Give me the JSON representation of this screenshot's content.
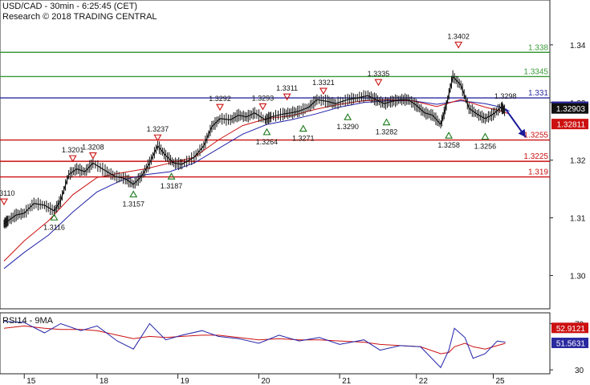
{
  "chart_data": {
    "type": "line",
    "title": "USD/CAD - 30min - 6:25:45 (CET)",
    "subtitle": "Research © 2018 TRADING CENTRAL",
    "ylim": [
      1.2945,
      1.3475
    ],
    "y_ticks": [
      1.3,
      1.31,
      1.32,
      1.33,
      1.34
    ],
    "y_tick_labels": [
      "1.30",
      "1.31",
      "1.32",
      "1.33",
      "1.34"
    ],
    "x_ticks": [
      {
        "label": "15",
        "x": 0.3
      },
      {
        "label": "18",
        "x": 1.2
      },
      {
        "label": "19",
        "x": 2.2
      },
      {
        "label": "20",
        "x": 3.2
      },
      {
        "label": "21",
        "x": 4.2
      },
      {
        "label": "22",
        "x": 5.15
      },
      {
        "label": "25",
        "x": 6.1
      }
    ],
    "xlim": [
      0,
      6.8
    ],
    "price_series": {
      "name": "USD/CAD",
      "points": [
        [
          0.05,
          1.309
        ],
        [
          0.1,
          1.3095
        ],
        [
          0.2,
          1.3105
        ],
        [
          0.3,
          1.3108
        ],
        [
          0.42,
          1.3125
        ],
        [
          0.55,
          1.3122
        ],
        [
          0.67,
          1.3112
        ],
        [
          0.75,
          1.313
        ],
        [
          0.85,
          1.3175
        ],
        [
          0.95,
          1.3185
        ],
        [
          1.05,
          1.318
        ],
        [
          1.15,
          1.3195
        ],
        [
          1.3,
          1.3182
        ],
        [
          1.42,
          1.3172
        ],
        [
          1.55,
          1.3168
        ],
        [
          1.65,
          1.3158
        ],
        [
          1.75,
          1.3172
        ],
        [
          1.85,
          1.3195
        ],
        [
          1.95,
          1.3225
        ],
        [
          2.05,
          1.3208
        ],
        [
          2.15,
          1.3195
        ],
        [
          2.25,
          1.3193
        ],
        [
          2.4,
          1.3205
        ],
        [
          2.52,
          1.3225
        ],
        [
          2.62,
          1.3258
        ],
        [
          2.72,
          1.3272
        ],
        [
          2.85,
          1.327
        ],
        [
          2.95,
          1.3278
        ],
        [
          3.05,
          1.3275
        ],
        [
          3.15,
          1.3282
        ],
        [
          3.28,
          1.327
        ],
        [
          3.35,
          1.3275
        ],
        [
          3.5,
          1.328
        ],
        [
          3.6,
          1.3282
        ],
        [
          3.7,
          1.3285
        ],
        [
          3.82,
          1.3292
        ],
        [
          3.92,
          1.3305
        ],
        [
          4.05,
          1.3302
        ],
        [
          4.15,
          1.3298
        ],
        [
          4.3,
          1.3305
        ],
        [
          4.42,
          1.3308
        ],
        [
          4.55,
          1.3312
        ],
        [
          4.65,
          1.3305
        ],
        [
          4.75,
          1.3298
        ],
        [
          4.85,
          1.3302
        ],
        [
          4.95,
          1.3305
        ],
        [
          5.05,
          1.3305
        ],
        [
          5.15,
          1.3295
        ],
        [
          5.25,
          1.3282
        ],
        [
          5.35,
          1.3278
        ],
        [
          5.45,
          1.3262
        ],
        [
          5.52,
          1.3295
        ],
        [
          5.6,
          1.3345
        ],
        [
          5.7,
          1.333
        ],
        [
          5.8,
          1.329
        ],
        [
          5.9,
          1.328
        ],
        [
          6.0,
          1.3272
        ],
        [
          6.1,
          1.328
        ],
        [
          6.2,
          1.3292
        ],
        [
          6.25,
          1.3285
        ]
      ]
    },
    "ma_fast": {
      "name": "MA (red)",
      "color": "#cc1111",
      "points": [
        [
          0.05,
          1.3025
        ],
        [
          0.3,
          1.306
        ],
        [
          0.6,
          1.3095
        ],
        [
          0.9,
          1.314
        ],
        [
          1.2,
          1.317
        ],
        [
          1.5,
          1.3178
        ],
        [
          1.8,
          1.3185
        ],
        [
          2.1,
          1.3195
        ],
        [
          2.4,
          1.3205
        ],
        [
          2.7,
          1.3235
        ],
        [
          3.0,
          1.326
        ],
        [
          3.3,
          1.3272
        ],
        [
          3.6,
          1.3277
        ],
        [
          3.9,
          1.3288
        ],
        [
          4.2,
          1.3297
        ],
        [
          4.5,
          1.3303
        ],
        [
          4.8,
          1.3305
        ],
        [
          5.1,
          1.3303
        ],
        [
          5.4,
          1.3293
        ],
        [
          5.7,
          1.3305
        ],
        [
          6.0,
          1.3292
        ],
        [
          6.2,
          1.3285
        ],
        [
          6.3,
          1.328
        ]
      ]
    },
    "ma_slow": {
      "name": "MA (blue)",
      "color": "#2222aa",
      "points": [
        [
          0.05,
          1.3012
        ],
        [
          0.3,
          1.304
        ],
        [
          0.6,
          1.307
        ],
        [
          0.9,
          1.311
        ],
        [
          1.2,
          1.3145
        ],
        [
          1.5,
          1.3165
        ],
        [
          1.8,
          1.3175
        ],
        [
          2.1,
          1.318
        ],
        [
          2.4,
          1.3195
        ],
        [
          2.7,
          1.322
        ],
        [
          3.0,
          1.3245
        ],
        [
          3.3,
          1.3262
        ],
        [
          3.6,
          1.327
        ],
        [
          3.9,
          1.328
        ],
        [
          4.2,
          1.3292
        ],
        [
          4.5,
          1.33
        ],
        [
          4.8,
          1.3303
        ],
        [
          5.1,
          1.3303
        ],
        [
          5.4,
          1.3297
        ],
        [
          5.7,
          1.3303
        ],
        [
          6.0,
          1.3298
        ],
        [
          6.2,
          1.3292
        ],
        [
          6.3,
          1.3285
        ]
      ]
    },
    "levels": [
      {
        "label": "1.338",
        "value": 1.3387,
        "color": "#3a9a3a"
      },
      {
        "label": "1.3345",
        "value": 1.3345,
        "color": "#3a9a3a"
      },
      {
        "label": "1.331",
        "value": 1.3308,
        "color": "#2a2aa0"
      },
      {
        "label": "1.3255",
        "value": 1.3235,
        "color": "#cc1111"
      },
      {
        "label": "1.3225",
        "value": 1.3198,
        "color": "#cc1111"
      },
      {
        "label": "1.319",
        "value": 1.3171,
        "color": "#cc1111"
      }
    ],
    "price_tags": [
      {
        "label": "1.32916",
        "value": 1.3292,
        "bg": "#2a2aa0",
        "fg": "#ffffff"
      },
      {
        "label": "1.32903",
        "value": 1.3289,
        "bg": "#111111",
        "fg": "#ffffff"
      },
      {
        "label": "1.32811",
        "value": 1.3262,
        "bg": "#cc1111",
        "fg": "#ffffff"
      }
    ],
    "annotations": [
      {
        "label": "1.3110",
        "x": 0.05,
        "value": 1.3123,
        "kind": "top"
      },
      {
        "label": "1.3116",
        "x": 0.67,
        "value": 1.3106,
        "kind": "bottom"
      },
      {
        "label": "1.3201",
        "x": 0.9,
        "value": 1.3198,
        "kind": "top"
      },
      {
        "label": "1.3208",
        "x": 1.15,
        "value": 1.3203,
        "kind": "top"
      },
      {
        "label": "1.3157",
        "x": 1.65,
        "value": 1.3146,
        "kind": "bottom"
      },
      {
        "label": "1.3237",
        "x": 1.95,
        "value": 1.3234,
        "kind": "top"
      },
      {
        "label": "1.3187",
        "x": 2.12,
        "value": 1.3177,
        "kind": "bottom"
      },
      {
        "label": "1.3292",
        "x": 2.72,
        "value": 1.3287,
        "kind": "top"
      },
      {
        "label": "1.3264",
        "x": 3.3,
        "value": 1.3254,
        "kind": "bottom"
      },
      {
        "label": "1.3293",
        "x": 3.25,
        "value": 1.3288,
        "kind": "top"
      },
      {
        "label": "1.3311",
        "x": 3.55,
        "value": 1.3305,
        "kind": "top"
      },
      {
        "label": "1.3271",
        "x": 3.75,
        "value": 1.326,
        "kind": "bottom"
      },
      {
        "label": "1.3321",
        "x": 4.0,
        "value": 1.3315,
        "kind": "top"
      },
      {
        "label": "1.3290",
        "x": 4.3,
        "value": 1.328,
        "kind": "bottom"
      },
      {
        "label": "1.3335",
        "x": 4.68,
        "value": 1.333,
        "kind": "top"
      },
      {
        "label": "1.3282",
        "x": 4.78,
        "value": 1.3271,
        "kind": "bottom"
      },
      {
        "label": "1.3258",
        "x": 5.55,
        "value": 1.3248,
        "kind": "bottom"
      },
      {
        "label": "1.3402",
        "x": 5.67,
        "value": 1.3395,
        "kind": "top"
      },
      {
        "label": "1.3256",
        "x": 6.0,
        "value": 1.3246,
        "kind": "bottom"
      },
      {
        "label": "1.3298",
        "x": 6.25,
        "value": 1.3298,
        "kind": "label"
      }
    ],
    "forecast_arrow": {
      "color": "#1a1a9a",
      "points": [
        [
          6.25,
          1.3289
        ],
        [
          6.5,
          1.324
        ]
      ]
    },
    "rsi": {
      "title": "RSI14 - 9MA",
      "ylim": [
        28,
        78
      ],
      "ticks": [
        30,
        70
      ],
      "tick_labels": [
        "30",
        "70"
      ],
      "tags": [
        {
          "label": "52.9121",
          "value": 66,
          "bg": "#cc1111",
          "fg": "#ffffff"
        },
        {
          "label": "51.5631",
          "value": 53,
          "bg": "#2a2aa0",
          "fg": "#ffffff"
        }
      ],
      "rsi_series": {
        "name": "RSI14",
        "color": "#2222aa",
        "points": [
          [
            0.05,
            72
          ],
          [
            0.3,
            71
          ],
          [
            0.55,
            62
          ],
          [
            0.75,
            70
          ],
          [
            1.0,
            64
          ],
          [
            1.2,
            68
          ],
          [
            1.45,
            55
          ],
          [
            1.65,
            48
          ],
          [
            1.85,
            70
          ],
          [
            2.05,
            56
          ],
          [
            2.25,
            60
          ],
          [
            2.5,
            64
          ],
          [
            2.7,
            59
          ],
          [
            2.95,
            57
          ],
          [
            3.2,
            53
          ],
          [
            3.45,
            60
          ],
          [
            3.7,
            55
          ],
          [
            3.95,
            58
          ],
          [
            4.2,
            52
          ],
          [
            4.5,
            56
          ],
          [
            4.7,
            47
          ],
          [
            4.95,
            51
          ],
          [
            5.2,
            50
          ],
          [
            5.45,
            32
          ],
          [
            5.55,
            47
          ],
          [
            5.62,
            66
          ],
          [
            5.75,
            58
          ],
          [
            5.85,
            40
          ],
          [
            6.0,
            44
          ],
          [
            6.15,
            55
          ],
          [
            6.25,
            54
          ]
        ]
      },
      "ma_series": {
        "name": "9MA",
        "color": "#cc1111",
        "points": [
          [
            0.05,
            66
          ],
          [
            0.3,
            68
          ],
          [
            0.55,
            66
          ],
          [
            0.75,
            65
          ],
          [
            1.0,
            65
          ],
          [
            1.2,
            64
          ],
          [
            1.45,
            60
          ],
          [
            1.65,
            57
          ],
          [
            1.85,
            59
          ],
          [
            2.05,
            58
          ],
          [
            2.25,
            59
          ],
          [
            2.5,
            60
          ],
          [
            2.7,
            60
          ],
          [
            2.95,
            58
          ],
          [
            3.2,
            56
          ],
          [
            3.45,
            57
          ],
          [
            3.7,
            56
          ],
          [
            3.95,
            56
          ],
          [
            4.2,
            55
          ],
          [
            4.5,
            54
          ],
          [
            4.7,
            52
          ],
          [
            4.95,
            51
          ],
          [
            5.2,
            50
          ],
          [
            5.45,
            44
          ],
          [
            5.55,
            45
          ],
          [
            5.62,
            50
          ],
          [
            5.75,
            53
          ],
          [
            5.85,
            50
          ],
          [
            6.0,
            48
          ],
          [
            6.15,
            51
          ],
          [
            6.25,
            53
          ]
        ]
      }
    }
  }
}
